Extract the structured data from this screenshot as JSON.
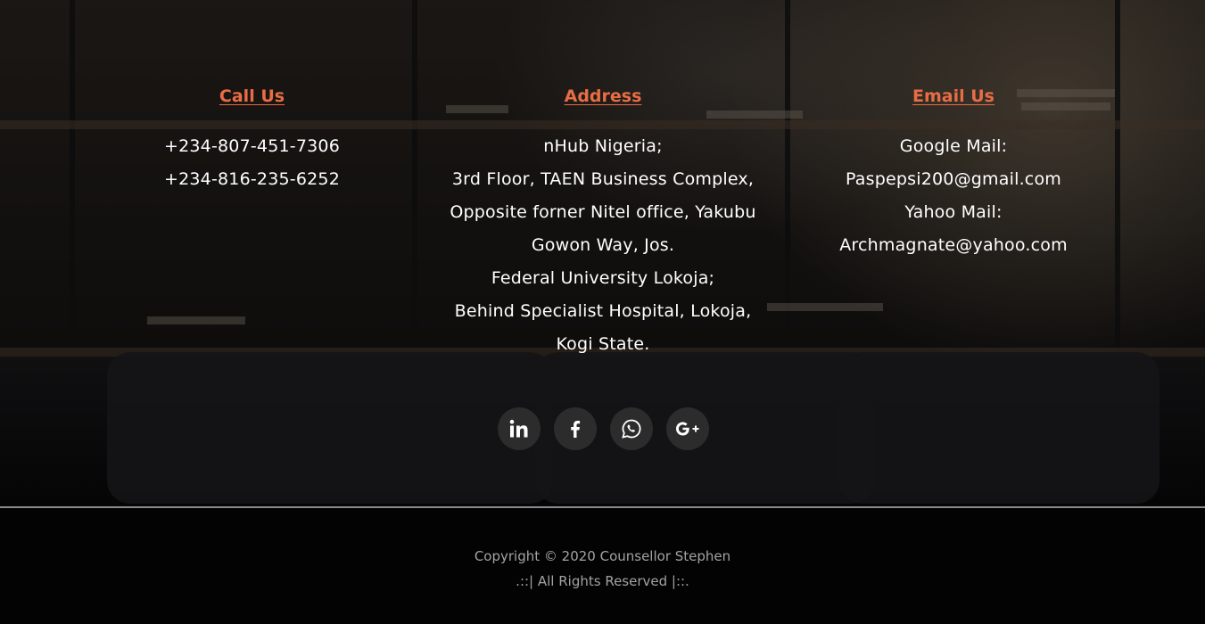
{
  "columns": {
    "call": {
      "heading": "Call Us",
      "lines": [
        "+234-807-451-7306",
        "+234-816-235-6252"
      ]
    },
    "address": {
      "heading": "Address",
      "lines": [
        "nHub Nigeria;",
        "3rd Floor, TAEN Business Complex,",
        "Opposite forner Nitel office, Yakubu",
        "Gowon Way, Jos.",
        "Federal University Lokoja;",
        "Behind Specialist Hospital, Lokoja,",
        "Kogi State."
      ]
    },
    "email": {
      "heading": "Email Us",
      "lines": [
        "Google Mail:",
        "Paspepsi200@gmail.com",
        "Yahoo Mail:",
        "Archmagnate@yahoo.com"
      ]
    }
  },
  "social": [
    {
      "name": "linkedin-icon"
    },
    {
      "name": "facebook-icon"
    },
    {
      "name": "whatsapp-icon"
    },
    {
      "name": "google-plus-icon"
    }
  ],
  "footer": {
    "copyright": "Copyright © 2020 Counsellor Stephen",
    "rights": ".::| All Rights Reserved |::."
  },
  "colors": {
    "accent": "#e86d44",
    "text": "#ffffff",
    "muted": "#a3a3a3",
    "social_bg": "#2c2c2c"
  }
}
